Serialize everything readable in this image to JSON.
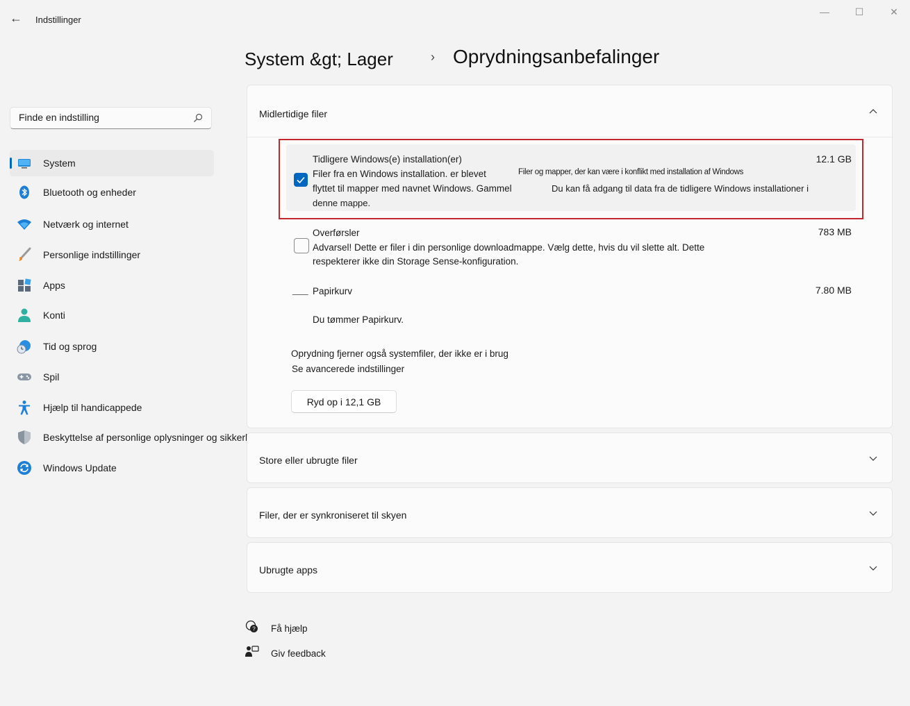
{
  "window": {
    "app_title": "Indstillinger",
    "back_glyph": "←",
    "minimize_glyph": "—",
    "maximize_glyph": "☐",
    "close_glyph": "✕"
  },
  "breadcrumb": {
    "parent": "System &gt; Lager",
    "separator": "›",
    "current": "Oprydningsanbefalinger"
  },
  "search": {
    "placeholder": "Finde en indstilling",
    "icon": "search-icon"
  },
  "sidebar": {
    "items": [
      {
        "label": "System",
        "icon": "system-monitor-icon"
      },
      {
        "label": "Bluetooth og enheder",
        "icon": "bluetooth-icon"
      },
      {
        "label": "Netværk og internet",
        "icon": "wifi-icon"
      },
      {
        "label": "Personlige indstillinger",
        "icon": "paintbrush-icon"
      },
      {
        "label": "Apps",
        "icon": "apps-icon"
      },
      {
        "label": "Konti",
        "icon": "person-icon"
      },
      {
        "label": "Tid og sprog",
        "icon": "clock-globe-icon"
      },
      {
        "label": "Spil",
        "icon": "gamepad-icon"
      },
      {
        "label": "Hjælp til handicappede",
        "icon": "accessibility-icon"
      },
      {
        "label": "Beskyttelse af personlige oplysninger og sikkerhed",
        "icon": "shield-icon"
      },
      {
        "label": "Windows Update",
        "icon": "windows-update-icon"
      }
    ],
    "active_color": "#0067c0"
  },
  "temp_files": {
    "title": "Midlertidige filer",
    "previous_install": {
      "title": "Tidligere Windows(e) installation(er)",
      "size": "12.1 GB",
      "checked": true,
      "desc_line1": "Filer fra en Windows installation. er blevet",
      "desc_line2": "flyttet til mapper med navnet Windows. Gammel",
      "desc_line3": "denne mappe.",
      "overlay_small": "Filer og mapper, der kan være i konflikt med installation af Windows",
      "overlay_line": "Du kan få adgang til data fra de tidligere Windows installationer i"
    },
    "downloads": {
      "title": "Overførsler",
      "size": "783 MB",
      "checked": false,
      "desc_line1": "Advarsel! Dette er filer i din personlige downloadmappe. Vælg dette, hvis du vil slette alt. Dette",
      "desc_line2": "respekterer ikke din Storage Sense-konfiguration."
    },
    "recycle_bin": {
      "prefix": "___",
      "title": "Papirkurv",
      "size": "7.80 MB",
      "desc": "Du tømmer Papirkurv."
    },
    "note": "Oprydning fjerner også systemfiler, der ikke er i brug",
    "advanced_link": "Se avancerede indstillinger",
    "cleanup_button": "Ryd op i 12,1 GB"
  },
  "sections": [
    {
      "title": "Store eller ubrugte filer"
    },
    {
      "title": "Filer, der er synkroniseret til skyen"
    },
    {
      "title": "Ubrugte apps"
    }
  ],
  "footer": {
    "help": "Få hjælp",
    "feedback": "Giv feedback"
  },
  "colors": {
    "accent": "#0067c0",
    "highlight_border": "#c4262e"
  }
}
